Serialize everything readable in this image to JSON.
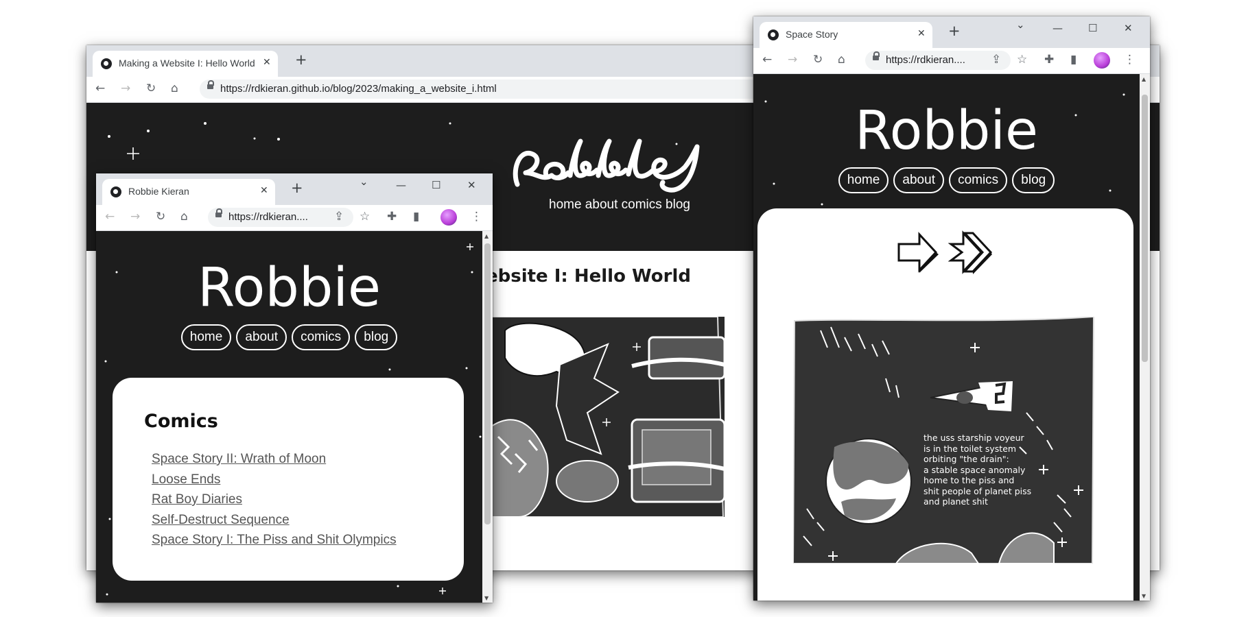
{
  "windows": {
    "blog": {
      "tab_title": "Making a Website I: Hello World",
      "url": "https://rdkieran.github.io/blog/2023/making_a_website_i.html",
      "nav_text": "home about comics blog",
      "heading": "ebsite I: Hello World"
    },
    "home": {
      "tab_title": "Robbie Kieran",
      "url": "https://rdkieran....",
      "site_title": "Robbie",
      "nav": [
        "home",
        "about",
        "comics",
        "blog"
      ],
      "section_heading": "Comics",
      "comics": [
        "Space Story II: Wrath of Moon",
        "Loose Ends",
        "Rat Boy Diaries",
        "Self-Destruct Sequence",
        "Space Story I: The Piss and Shit Olympics"
      ]
    },
    "story": {
      "tab_title": "Space Story",
      "url": "https://rdkieran....",
      "site_title": "Robbie",
      "nav": [
        "home",
        "about",
        "comics",
        "blog"
      ],
      "caption_lines": [
        "the uss starship voyeur",
        "is in the toilet system",
        "orbiting \"the drain\":",
        "a stable space anomaly",
        "home to the piss and",
        "shit people of planet piss",
        "and planet shit"
      ]
    }
  },
  "icons": {
    "close": "✕",
    "new_tab": "+",
    "back": "←",
    "forward": "→",
    "reload": "↻",
    "home": "⌂",
    "star": "☆",
    "share": "⇪",
    "extensions": "✚",
    "sidepanel": "▮",
    "menu": "⋮",
    "minimize": "—",
    "maximize": "☐",
    "chevron": "⌄"
  },
  "colors": {
    "site_bg": "#1d1d1d",
    "tabstrip": "#dee1e6",
    "link": "#555555",
    "card": "#ffffff"
  }
}
